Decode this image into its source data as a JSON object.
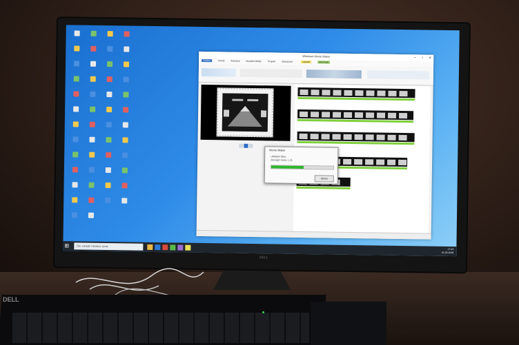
{
  "window": {
    "title": "Windows Movie Maker"
  },
  "ribbon": {
    "tabs": [
      "Soubor",
      "Domů",
      "Animace",
      "Vizuální efekty",
      "Projekt",
      "Zobrazení",
      "Upravit",
      "Možnosti"
    ]
  },
  "dialog": {
    "title": "Movie Maker",
    "message": "Ukládání filmu",
    "sub": "Zbývající doba: 1:25",
    "progress": 0.52,
    "cancel_label": "Storno"
  },
  "taskbar": {
    "search_placeholder": "Zde zadejte hledaný výraz",
    "time": "17:23",
    "date": "31.03.2016"
  },
  "monitor": {
    "brand": "DELL"
  },
  "keyboard": {
    "brand": "DELL"
  },
  "colors": {
    "desktop_blue": "#2f8ce8",
    "progress_green": "#2fb62f",
    "timeline_green": "#7ecf3a"
  }
}
